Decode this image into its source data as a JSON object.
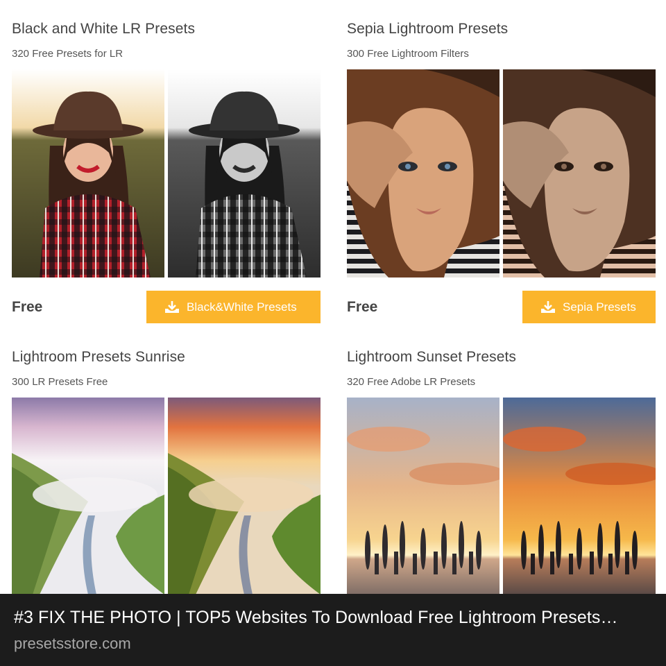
{
  "cards": [
    {
      "title": "Black and White LR Presets",
      "subtitle": "320 Free Presets for LR",
      "price": "Free",
      "button_label": "Black&White Presets",
      "button_icon": "download-icon"
    },
    {
      "title": "Sepia Lightroom Presets",
      "subtitle": "300 Free Lightroom Filters",
      "price": "Free",
      "button_label": "Sepia Presets",
      "button_icon": "download-icon"
    },
    {
      "title": "Lightroom Presets Sunrise",
      "subtitle": "300 LR Presets Free"
    },
    {
      "title": "Lightroom Sunset Presets",
      "subtitle": "320 Free Adobe LR Presets"
    }
  ],
  "caption": {
    "title": "#3 FIX THE PHOTO | TOP5 Websites To Download Free Lightroom Presets…",
    "domain": "presetsstore.com"
  },
  "colors": {
    "button_bg": "#fbb52c",
    "caption_bg": "#1c1c1c"
  }
}
